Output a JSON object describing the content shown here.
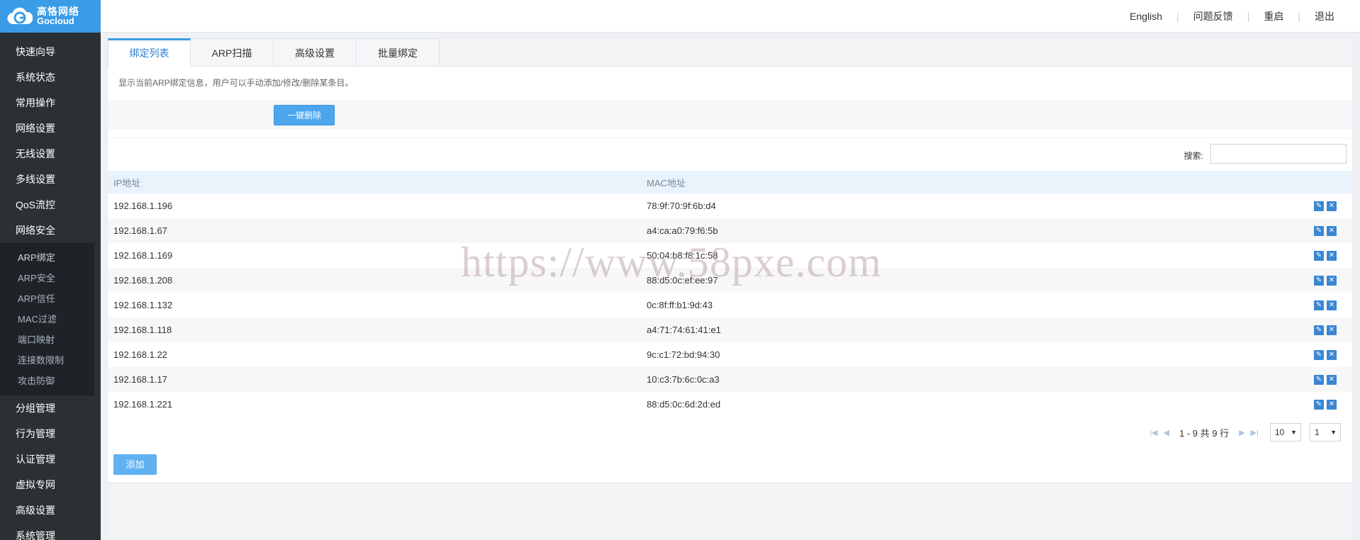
{
  "brand": {
    "name_cn": "高恪网络",
    "name_en": "Gocloud",
    "color": "#3a9be6"
  },
  "top_links": [
    "English",
    "问题反馈",
    "重启",
    "退出"
  ],
  "sidebar": {
    "items_before": [
      "快速向导",
      "系统状态",
      "常用操作",
      "网络设置",
      "无线设置",
      "多线设置",
      "QoS流控",
      "网络安全"
    ],
    "submenu": [
      "ARP绑定",
      "ARP安全",
      "ARP信任",
      "MAC过滤",
      "端口映射",
      "连接数限制",
      "攻击防御"
    ],
    "items_after": [
      "分组管理",
      "行为管理",
      "认证管理",
      "虚拟专网",
      "高级设置",
      "系统管理"
    ]
  },
  "tabs": [
    "绑定列表",
    "ARP扫描",
    "高级设置",
    "批量绑定"
  ],
  "description": "显示当前ARP绑定信息，用户可以手动添加/修改/删除某条目。",
  "delete_all_button": "一键删除",
  "search_label": "搜索:",
  "table": {
    "headers": {
      "ip": "IP地址",
      "mac": "MAC地址"
    },
    "rows": [
      {
        "ip": "192.168.1.196",
        "mac": "78:9f:70:9f:6b:d4"
      },
      {
        "ip": "192.168.1.67",
        "mac": "a4:ca:a0:79:f6:5b"
      },
      {
        "ip": "192.168.1.169",
        "mac": "50:04:b8:f8:1c:58"
      },
      {
        "ip": "192.168.1.208",
        "mac": "88:d5:0c:ef:ee:97"
      },
      {
        "ip": "192.168.1.132",
        "mac": "0c:8f:ff:b1:9d:43"
      },
      {
        "ip": "192.168.1.118",
        "mac": "a4:71:74:61:41:e1"
      },
      {
        "ip": "192.168.1.22",
        "mac": "9c:c1:72:bd:94:30"
      },
      {
        "ip": "192.168.1.17",
        "mac": "10:c3:7b:6c:0c:a3"
      },
      {
        "ip": "192.168.1.221",
        "mac": "88:d5:0c:6d:2d:ed"
      }
    ]
  },
  "pager": {
    "info": "1 - 9 共 9 行",
    "page_size": "10",
    "page": "1"
  },
  "add_button": "添加",
  "watermark": "https://www.58pxe.com"
}
